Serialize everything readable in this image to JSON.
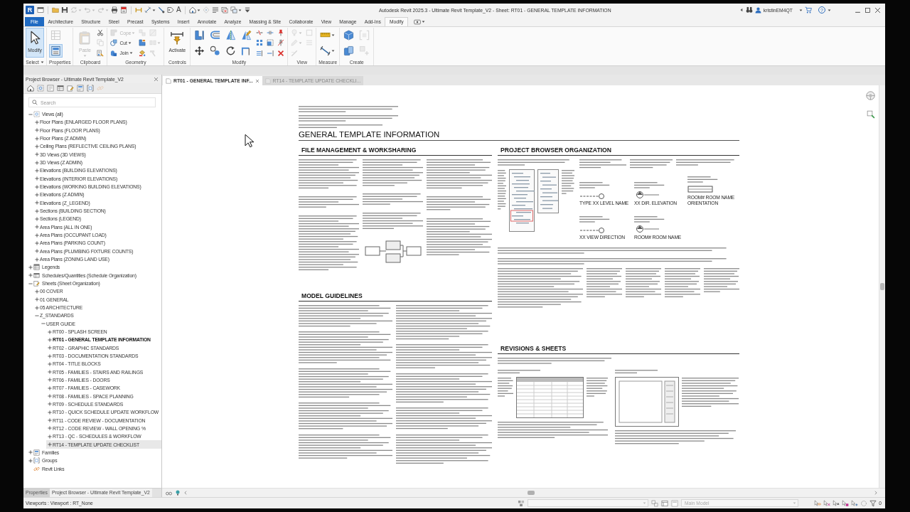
{
  "window": {
    "logo": "R",
    "title": "Autodesk Revit 2025.3 - Ultimate Revit Template_V2 - Sheet: RT01 - GENERAL TEMPLATE INFORMATION",
    "user": "kristinEM4QT",
    "help": "?"
  },
  "quick_access": [
    {
      "disabled": false,
      "menu": false
    },
    {
      "disabled": false,
      "menu": false
    },
    {
      "disabled": false,
      "menu": false
    },
    {
      "disabled": true,
      "menu": true
    },
    {
      "disabled": true,
      "menu": true
    },
    {
      "disabled": true,
      "menu": true
    },
    {
      "disabled": false,
      "menu": false
    },
    {
      "disabled": false,
      "menu": false
    },
    {
      "disabled": false,
      "menu": false
    },
    {
      "disabled": false,
      "menu": true
    },
    {
      "disabled": false,
      "menu": false
    },
    {
      "disabled": false,
      "menu": false
    },
    {
      "glyph": "A",
      "disabled": false,
      "menu": false
    },
    {
      "disabled": false,
      "menu": true
    },
    {
      "disabled": true,
      "menu": false
    },
    {
      "disabled": false,
      "menu": false
    },
    {
      "disabled": false,
      "menu": false
    },
    {
      "disabled": false,
      "menu": true
    },
    {
      "disabled": false,
      "menu": false
    }
  ],
  "ribbon": {
    "tabs": [
      {
        "label": "File",
        "kind": "file",
        "selected": false
      },
      {
        "label": "Architecture",
        "kind": "tab",
        "selected": false
      },
      {
        "label": "Structure",
        "kind": "tab",
        "selected": false
      },
      {
        "label": "Steel",
        "kind": "tab",
        "selected": false
      },
      {
        "label": "Precast",
        "kind": "tab",
        "selected": false
      },
      {
        "label": "Systems",
        "kind": "tab",
        "selected": false
      },
      {
        "label": "Insert",
        "kind": "tab",
        "selected": false
      },
      {
        "label": "Annotate",
        "kind": "tab",
        "selected": false
      },
      {
        "label": "Analyze",
        "kind": "tab",
        "selected": false
      },
      {
        "label": "Massing & Site",
        "kind": "tab",
        "selected": false
      },
      {
        "label": "Collaborate",
        "kind": "tab",
        "selected": false
      },
      {
        "label": "View",
        "kind": "tab",
        "selected": false
      },
      {
        "label": "Manage",
        "kind": "tab",
        "selected": false
      },
      {
        "label": "Add-Ins",
        "kind": "tab",
        "selected": false
      },
      {
        "label": "Modify",
        "kind": "tab",
        "selected": true
      }
    ],
    "panels": [
      {
        "label": "Select",
        "menu": true,
        "tools": [
          {
            "kind": "large",
            "label": "Modify",
            "selected": true,
            "disabled": false,
            "menu": false
          }
        ]
      },
      {
        "label": "Properties",
        "menu": false,
        "tools": [
          {
            "kind": "half",
            "selected": false,
            "disabled": true,
            "menu": false
          },
          {
            "kind": "half",
            "selected": true,
            "disabled": false,
            "menu": false
          }
        ]
      },
      {
        "label": "Clipboard",
        "menu": false,
        "tools": [
          {
            "kind": "large",
            "label": "Paste",
            "selected": false,
            "disabled": true,
            "menu": true
          },
          {
            "kind": "small",
            "selected": false,
            "disabled": false,
            "menu": false
          },
          {
            "kind": "small",
            "selected": false,
            "disabled": true,
            "menu": false
          },
          {
            "kind": "small",
            "selected": false,
            "disabled": false,
            "menu": false
          }
        ]
      },
      {
        "label": "Geometry",
        "menu": false,
        "tools": [
          {
            "kind": "small",
            "label": "Cope",
            "selected": false,
            "disabled": true,
            "menu": true
          },
          {
            "kind": "small",
            "label": "Cut",
            "selected": false,
            "disabled": false,
            "menu": true
          },
          {
            "kind": "small",
            "label": "Join",
            "selected": false,
            "disabled": false,
            "menu": true
          },
          {
            "kind": "small",
            "selected": false,
            "disabled": true,
            "menu": false
          },
          {
            "kind": "small",
            "selected": false,
            "disabled": false,
            "menu": false
          },
          {
            "kind": "small",
            "selected": false,
            "disabled": false,
            "menu": false
          },
          {
            "kind": "small",
            "selected": false,
            "disabled": true,
            "menu": false
          },
          {
            "kind": "small",
            "selected": false,
            "disabled": true,
            "menu": true
          },
          {
            "kind": "small",
            "selected": false,
            "disabled": true,
            "menu": false
          }
        ]
      },
      {
        "label": "Controls",
        "menu": false,
        "tools": [
          {
            "kind": "large",
            "label": "Activate",
            "selected": false,
            "disabled": false,
            "menu": false
          }
        ]
      },
      {
        "label": "Modify",
        "menu": false,
        "tools": [
          {
            "kind": "half",
            "selected": false,
            "disabled": false,
            "menu": false
          },
          {
            "kind": "half",
            "selected": false,
            "disabled": false,
            "menu": false
          },
          {
            "kind": "half",
            "selected": false,
            "disabled": false,
            "menu": false
          },
          {
            "kind": "half",
            "selected": false,
            "disabled": false,
            "menu": false
          },
          {
            "kind": "half",
            "selected": false,
            "disabled": false,
            "menu": false
          },
          {
            "kind": "half",
            "selected": false,
            "disabled": false,
            "menu": false
          },
          {
            "kind": "half",
            "selected": false,
            "disabled": false,
            "menu": false
          },
          {
            "kind": "half",
            "selected": false,
            "disabled": false,
            "menu": false
          },
          {
            "kind": "small",
            "selected": false,
            "disabled": false,
            "menu": false
          },
          {
            "kind": "small",
            "selected": false,
            "disabled": false,
            "menu": false
          },
          {
            "kind": "small",
            "selected": false,
            "disabled": false,
            "menu": false
          },
          {
            "kind": "small",
            "selected": false,
            "disabled": false,
            "menu": false
          },
          {
            "kind": "small",
            "selected": false,
            "disabled": false,
            "menu": false
          },
          {
            "kind": "small",
            "selected": false,
            "disabled": false,
            "menu": false
          },
          {
            "kind": "small",
            "selected": false,
            "disabled": false,
            "menu": false
          },
          {
            "kind": "small",
            "selected": false,
            "disabled": false,
            "menu": false
          },
          {
            "kind": "small",
            "selected": false,
            "disabled": false,
            "menu": false
          }
        ]
      },
      {
        "label": "View",
        "menu": false,
        "tools": [
          {
            "kind": "small",
            "selected": false,
            "disabled": true,
            "menu": true
          },
          {
            "kind": "small",
            "selected": false,
            "disabled": true,
            "menu": true
          },
          {
            "kind": "small",
            "selected": false,
            "disabled": true,
            "menu": false
          },
          {
            "kind": "small",
            "selected": false,
            "disabled": true,
            "menu": false
          },
          {
            "kind": "small",
            "selected": false,
            "disabled": true,
            "menu": false
          }
        ]
      },
      {
        "label": "Measure",
        "menu": false,
        "tools": [
          {
            "kind": "half",
            "selected": false,
            "disabled": false,
            "menu": true
          },
          {
            "kind": "half",
            "selected": false,
            "disabled": false,
            "menu": true
          }
        ]
      },
      {
        "label": "Create",
        "menu": false,
        "tools": [
          {
            "kind": "half",
            "selected": false,
            "disabled": false,
            "menu": false
          },
          {
            "kind": "half",
            "selected": false,
            "disabled": false,
            "menu": false
          },
          {
            "kind": "half",
            "selected": false,
            "disabled": true,
            "menu": false
          },
          {
            "kind": "half",
            "selected": false,
            "disabled": true,
            "menu": false
          }
        ]
      }
    ]
  },
  "project_browser": {
    "title": "Project Browser - Ultimate Revit Template_V2",
    "toolbar": [
      {
        "disabled": false
      },
      {
        "disabled": false
      },
      {
        "disabled": false
      },
      {
        "disabled": false
      },
      {
        "disabled": false
      },
      {
        "disabled": false
      },
      {
        "disabled": false
      },
      {
        "disabled": true
      }
    ],
    "search": {
      "placeholder": "Search"
    },
    "tree": [
      {
        "label": "Views (all)",
        "kind": "views",
        "expanded": true,
        "children": [
          {
            "label": "Floor Plans (ENLARGED FLOOR PLANS)",
            "expanded": false
          },
          {
            "label": "Floor Plans (FLOOR PLANS)",
            "expanded": false
          },
          {
            "label": "Floor Plans (Z ADMIN)",
            "expanded": false
          },
          {
            "label": "Ceiling Plans (REFLECTIVE CEILING PLANS)",
            "expanded": false
          },
          {
            "label": "3D Views (3D VIEWS)",
            "expanded": false
          },
          {
            "label": "3D Views (Z ADMIN)",
            "expanded": false
          },
          {
            "label": "Elevations (BUILDING ELEVATIONS)",
            "expanded": false
          },
          {
            "label": "Elevations (INTERIOR ELEVATIONS)",
            "expanded": false
          },
          {
            "label": "Elevations (WORKING BUILDING ELEVATIONS)",
            "expanded": false
          },
          {
            "label": "Elevations (Z ADMIN)",
            "expanded": false
          },
          {
            "label": "Elevations (Z_LEGEND)",
            "expanded": false
          },
          {
            "label": "Sections (BUILDING SECTION)",
            "expanded": false
          },
          {
            "label": "Sections (LEGEND)",
            "expanded": false
          },
          {
            "label": "Area Plans (ALL IN ONE)",
            "expanded": false
          },
          {
            "label": "Area Plans (OCCUPANT LOAD)",
            "expanded": false
          },
          {
            "label": "Area Plans (PARKING COUNT)",
            "expanded": false
          },
          {
            "label": "Area Plans (PLUMBING FIXTURE COUNTS)",
            "expanded": false
          },
          {
            "label": "Area Plans (ZONING LAND USE)",
            "expanded": false
          }
        ]
      },
      {
        "label": "Legends",
        "kind": "legends",
        "expanded": false
      },
      {
        "label": "Schedules/Quantities (Schedule Organization)",
        "kind": "schedules",
        "expanded": false
      },
      {
        "label": "Sheets (Sheet Organization)",
        "kind": "sheets",
        "expanded": true,
        "children": [
          {
            "label": "00 COVER",
            "expanded": false
          },
          {
            "label": "01 GENERAL",
            "expanded": false
          },
          {
            "label": "05 ARCHITECTURE",
            "expanded": false
          },
          {
            "label": "Z_STANDARDS",
            "expanded": true,
            "children": [
              {
                "label": "USER GUIDE",
                "expanded": true,
                "children": [
                  {
                    "label": "RT00 - SPLASH SCREEN",
                    "expanded": false,
                    "current": false,
                    "selected": false
                  },
                  {
                    "label": "RT01 - GENERAL TEMPLATE INFORMATION",
                    "expanded": false,
                    "current": true,
                    "selected": false
                  },
                  {
                    "label": "RT02 - GRAPHIC STANDARDS",
                    "expanded": false,
                    "current": false,
                    "selected": false
                  },
                  {
                    "label": "RT03 - DOCUMENTATION STANDARDS",
                    "expanded": false,
                    "current": false,
                    "selected": false
                  },
                  {
                    "label": "RT04 - TITLE BLOCKS",
                    "expanded": false,
                    "current": false,
                    "selected": false
                  },
                  {
                    "label": "RT05 - FAMILIES - STAIRS AND RAILINGS",
                    "expanded": false,
                    "current": false,
                    "selected": false
                  },
                  {
                    "label": "RT06 - FAMILIES - DOORS",
                    "expanded": false,
                    "current": false,
                    "selected": false
                  },
                  {
                    "label": "RT07 - FAMILIES - CASEWORK",
                    "expanded": false,
                    "current": false,
                    "selected": false
                  },
                  {
                    "label": "RT08 - FAMILIES - SPACE PLANNING",
                    "expanded": false,
                    "current": false,
                    "selected": false
                  },
                  {
                    "label": "RT09 - SCHEDULE STANDARDS",
                    "expanded": false,
                    "current": false,
                    "selected": false
                  },
                  {
                    "label": "RT10 - QUICK SCHEDULE UPDATE WORKFLOW",
                    "expanded": false,
                    "current": false,
                    "selected": false
                  },
                  {
                    "label": "RT11 - CODE REVIEW - DOCUMENTATION",
                    "expanded": false,
                    "current": false,
                    "selected": false
                  },
                  {
                    "label": "RT12 - CODE REVIEW - WALL OPENING %",
                    "expanded": false,
                    "current": false,
                    "selected": false
                  },
                  {
                    "label": "RT13 - QC - SCHEDULES & WORKFLOW",
                    "expanded": false,
                    "current": false,
                    "selected": false
                  },
                  {
                    "label": "RT14 - TEMPLATE UPDATE CHECKLIST",
                    "expanded": false,
                    "current": false,
                    "selected": true
                  }
                ]
              }
            ]
          }
        ]
      },
      {
        "label": "Families",
        "kind": "families",
        "expanded": false
      },
      {
        "label": "Groups",
        "kind": "groups",
        "expanded": false
      },
      {
        "label": "Revit Links",
        "kind": "links"
      }
    ],
    "tabs": [
      {
        "label": "Properties",
        "selected": false
      },
      {
        "label": "Project Browser - Ultimate Revit Template_V2",
        "selected": true
      }
    ]
  },
  "view_tabs": [
    {
      "label": "RT01 - GENERAL TEMPLATE INF...",
      "selected": true
    },
    {
      "label": "RT14 - TEMPLATE UPDATE CHECKLI...",
      "selected": false
    }
  ],
  "sheet": {
    "title": "GENERAL TEMPLATE INFORMATION",
    "sections": [
      {
        "heading": "FILE MANAGEMENT & WORKSHARING"
      },
      {
        "heading": "MODEL GUIDELINES"
      },
      {
        "heading": "PROJECT BROWSER ORGANIZATION",
        "labels": [
          "TYPE XX LEVEL NAME",
          "XX DIR. ELEVATION",
          "ROOM# ROOM NAME ORIENTATION",
          "XX VIEW DIRECTION",
          "ROOM# ROOM NAME"
        ]
      },
      {
        "heading": "REVISIONS & SHEETS"
      }
    ]
  },
  "status_bar": {
    "text": "Viewports : Viewport : RT_None",
    "workset": {
      "disabled": true
    },
    "design_option": {
      "value": "Main Model",
      "disabled": true
    },
    "filter_count": "0"
  }
}
